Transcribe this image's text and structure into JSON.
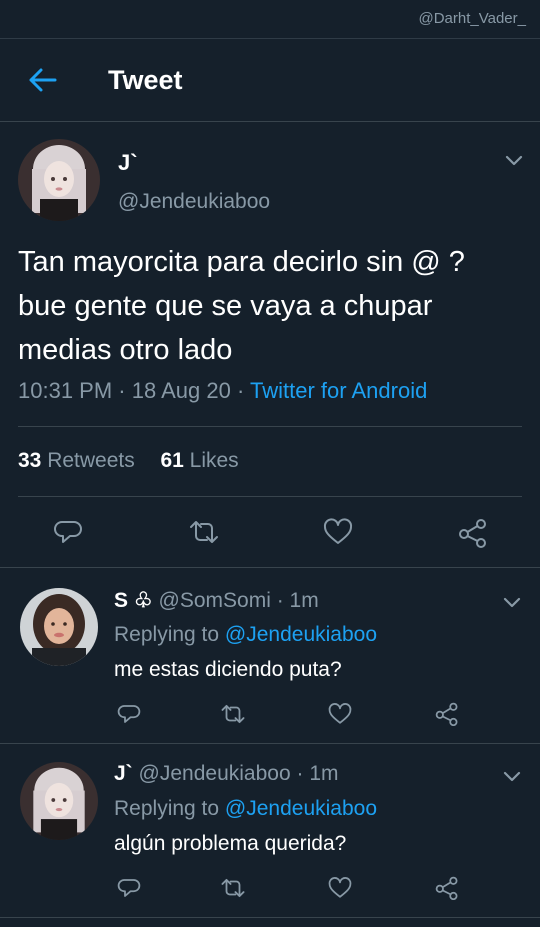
{
  "watermark": "@Darht_Vader_",
  "header": {
    "title": "Tweet"
  },
  "main_tweet": {
    "name": "J`",
    "handle": "@Jendeukiaboo",
    "text_lines": [
      "Tan mayorcita para decirlo sin @ ?",
      "bue gente que se vaya a chupar",
      "medias otro lado"
    ],
    "time": "10:31 PM",
    "date": "18 Aug 20",
    "source": "Twitter for Android",
    "retweets_count": "33",
    "retweets_label": "Retweets",
    "likes_count": "61",
    "likes_label": "Likes"
  },
  "replies": [
    {
      "name": "S ♧",
      "handle": "@SomSomi",
      "time": "1m",
      "replying_prefix": "Replying to",
      "replying_to": "@Jendeukiaboo",
      "text": "me estas diciendo puta?"
    },
    {
      "name": "J`",
      "handle": "@Jendeukiaboo",
      "time": "1m",
      "replying_prefix": "Replying to",
      "replying_to": "@Jendeukiaboo",
      "text": "algún problema querida?"
    }
  ],
  "icons": [
    "back-arrow-icon",
    "chevron-down-icon",
    "reply-icon",
    "retweet-icon",
    "like-icon",
    "share-icon"
  ],
  "colors": {
    "background": "#15202b",
    "accent": "#1da1f2",
    "muted": "#8899a6",
    "divider": "#38444d"
  }
}
